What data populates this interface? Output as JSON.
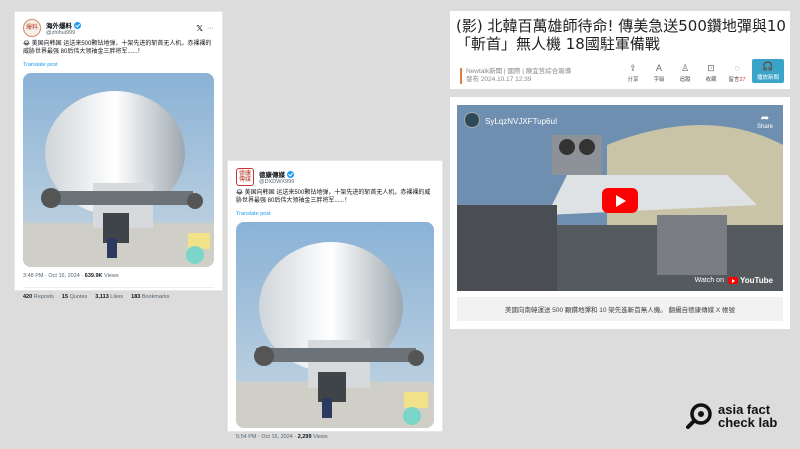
{
  "tweet1": {
    "display_name": "海外爆料",
    "handle": "@zhihui999",
    "text": "😂 美国向韩国 运送来500颗钻地弹，十架先进的斩首无人机，赤裸裸的威胁世界最强 80后伟大领袖金三胖将军......！",
    "translate": "Translate post",
    "time": "3:48 PM · Oct 16, 2024 ·",
    "views": "639.9K",
    "views_label": "Views",
    "stats": {
      "reposts": "420",
      "reposts_label": "Reposts",
      "quotes": "15",
      "quotes_label": "Quotes",
      "likes": "3,113",
      "likes_label": "Likes",
      "bookmarks": "183",
      "bookmarks_label": "Bookmarks"
    }
  },
  "tweet2": {
    "display_name": "德康傳媒",
    "handle": "@DXDWX999",
    "text": "😂 美国向韩国 运送来500颗钻地弹，十架先进的斩首无人机，赤裸裸的威胁世界最强 80后伟大领袖金三胖将军......！",
    "translate": "Translate post",
    "time": "5:54 PM · Oct 16, 2024 ·",
    "views": "2,299",
    "views_label": "Views"
  },
  "news": {
    "title": "(影) 北韓百萬雄師待命! 傳美急送500鑽地彈與10「斬首」無人機 18國駐軍備戰",
    "source": "Newtalk新聞 | 國際 | 陳宜哲綜合報導",
    "date": "發布 2024.10.17 12:39",
    "tools": [
      {
        "icon": "share-icon",
        "glyph": "⇪",
        "label": "分享"
      },
      {
        "icon": "font-size-icon",
        "glyph": "A",
        "label": "字級"
      },
      {
        "icon": "follow-icon",
        "glyph": "♙",
        "label": "追蹤"
      },
      {
        "icon": "bookmark-icon",
        "glyph": "⊡",
        "label": "收藏"
      },
      {
        "icon": "comment-icon",
        "glyph": "◌",
        "label": "留言"
      }
    ],
    "comment_count": "27",
    "listen_label": "播放新聞"
  },
  "video": {
    "title": "SyLqzNVJXFTup6uI",
    "share_label": "Share",
    "watch_on": "Watch on",
    "youtube": "YouTube",
    "caption": "美國向南韓運送 500 顆鑽地彈和 10 架先進斬首無人機。   翻攝自德康傳媒 X 帳號"
  },
  "logo": {
    "line1": "asia fact",
    "line2": "check lab"
  },
  "colors": {
    "background": "#dcdcdc",
    "link": "#1d9bf0",
    "accent": "#3aa3c8",
    "play": "#ff0000"
  }
}
